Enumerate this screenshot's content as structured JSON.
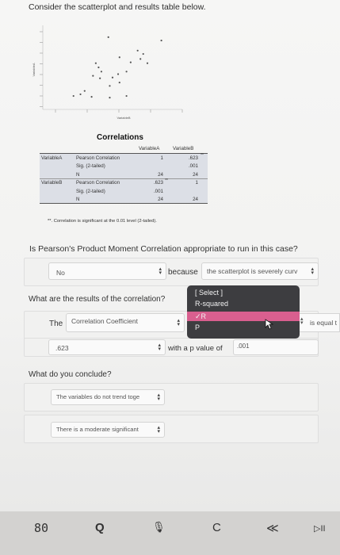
{
  "prompt": "Consider the scatterplot and results table below.",
  "scatter": {
    "ylabel": "VariableA",
    "xlabel": "VariableB",
    "points": [
      [
        0.47,
        0.86
      ],
      [
        0.85,
        0.82
      ],
      [
        0.55,
        0.62
      ],
      [
        0.72,
        0.66
      ],
      [
        0.63,
        0.56
      ],
      [
        0.38,
        0.55
      ],
      [
        0.4,
        0.5
      ],
      [
        0.42,
        0.45
      ],
      [
        0.36,
        0.4
      ],
      [
        0.41,
        0.37
      ],
      [
        0.54,
        0.42
      ],
      [
        0.6,
        0.45
      ],
      [
        0.5,
        0.38
      ],
      [
        0.55,
        0.32
      ],
      [
        0.48,
        0.28
      ],
      [
        0.3,
        0.22
      ],
      [
        0.27,
        0.18
      ],
      [
        0.22,
        0.16
      ],
      [
        0.35,
        0.15
      ],
      [
        0.48,
        0.14
      ],
      [
        0.6,
        0.16
      ],
      [
        0.7,
        0.6
      ],
      [
        0.75,
        0.55
      ],
      [
        0.68,
        0.7
      ]
    ]
  },
  "corr": {
    "title": "Correlations",
    "col_a": "VariableA",
    "col_b": "VariableB",
    "rows": [
      {
        "var": "VariableA",
        "stat": "Pearson Correlation",
        "a": "1",
        "b": ".623",
        "sup_b": "**"
      },
      {
        "var": "",
        "stat": "Sig. (2-tailed)",
        "a": "",
        "b": ".001"
      },
      {
        "var": "",
        "stat": "N",
        "a": "24",
        "b": "24"
      },
      {
        "var": "VariableB",
        "stat": "Pearson Correlation",
        "a": ".623",
        "sup_a": "**",
        "b": "1"
      },
      {
        "var": "",
        "stat": "Sig. (2-tailed)",
        "a": ".001",
        "b": ""
      },
      {
        "var": "",
        "stat": "N",
        "a": "24",
        "b": "24"
      }
    ],
    "footnote": "**. Correlation is significant at the 0.01 level (2-tailed)."
  },
  "q1": {
    "text": "Is Pearson's Product Moment Correlation appropriate to run in this case?",
    "answer": "No",
    "because": "because",
    "reason": "the scatterplot is severely curv"
  },
  "q2": {
    "text": "What are the results of the correlation?",
    "the": "The",
    "stat": "Correlation Coefficient",
    "is_equal": "is equal t",
    "value": ".623",
    "with_p": "with a p value of",
    "p": ".001",
    "popup": [
      "[ Select ]",
      "R-squared",
      "✓R",
      "P"
    ]
  },
  "q3": {
    "text": "What do you conclude?",
    "a1": "The variables do not trend toge",
    "a2": "There is a moderate significant"
  },
  "nav": [
    "80",
    "Q",
    "🎙",
    "C",
    "≪",
    "▷II"
  ]
}
